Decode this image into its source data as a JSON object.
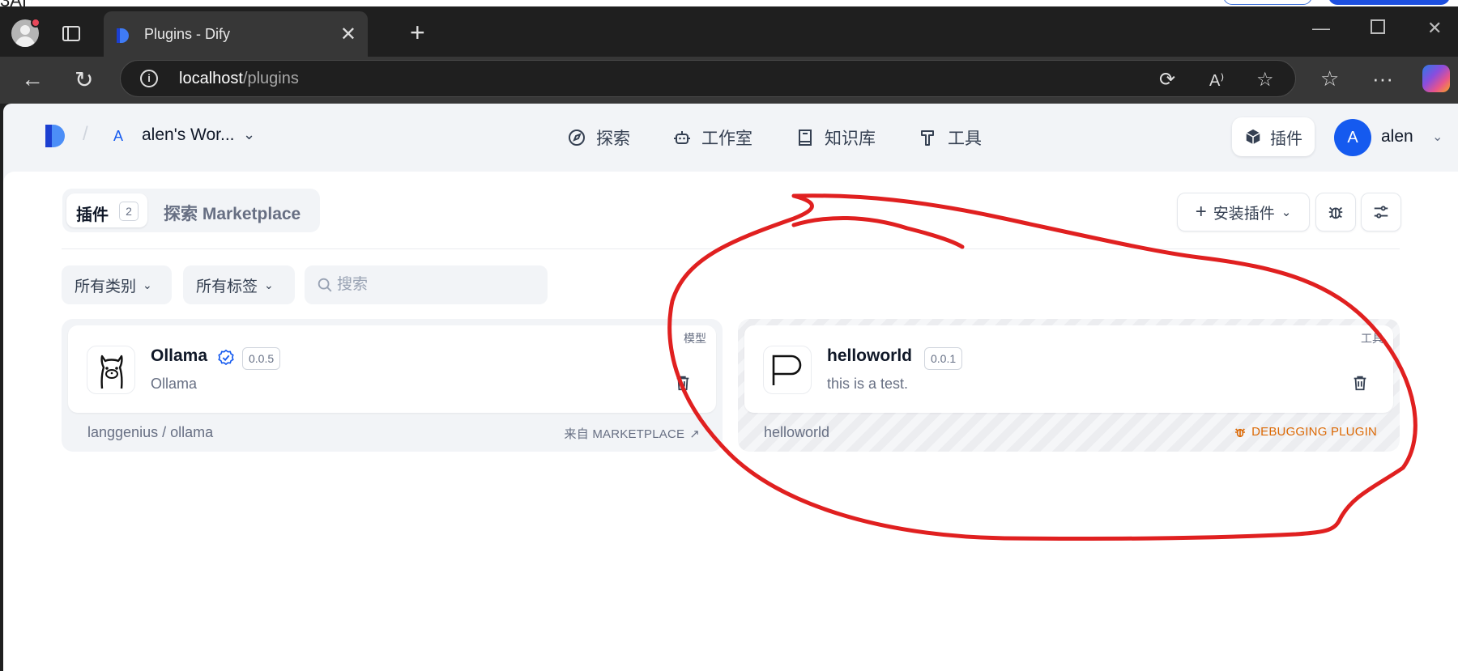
{
  "browser": {
    "tab_title": "Plugins - Dify",
    "url_host": "localhost",
    "url_path": "/plugins"
  },
  "app": {
    "workspace_initial": "A",
    "workspace_name": "alen's Wor...",
    "nav": [
      {
        "label": "探索",
        "icon": "compass-icon"
      },
      {
        "label": "工作室",
        "icon": "robot-icon"
      },
      {
        "label": "知识库",
        "icon": "book-icon"
      },
      {
        "label": "工具",
        "icon": "hammer-icon"
      }
    ],
    "plugins_button": "插件",
    "user_initial": "A",
    "user_name": "alen"
  },
  "tabs": {
    "plugins_label": "插件",
    "plugins_count": "2",
    "marketplace_label": "探索 Marketplace"
  },
  "actions": {
    "install_label": "安装插件"
  },
  "filters": {
    "category": "所有类别",
    "tags": "所有标签",
    "search_placeholder": "搜索"
  },
  "plugins": [
    {
      "name": "Ollama",
      "version": "0.0.5",
      "description": "Ollama",
      "tag": "模型",
      "source_org": "langgenius",
      "source_name": "ollama",
      "source_label": "来自 MARKETPLACE",
      "verified": true
    },
    {
      "name": "helloworld",
      "version": "0.0.1",
      "description": "this is a test.",
      "tag": "工具",
      "source_name": "helloworld",
      "source_label": "DEBUGGING PLUGIN",
      "verified": false
    }
  ],
  "colors": {
    "accent": "#155aef",
    "debug": "#dc6803",
    "annotation": "#e02020"
  }
}
